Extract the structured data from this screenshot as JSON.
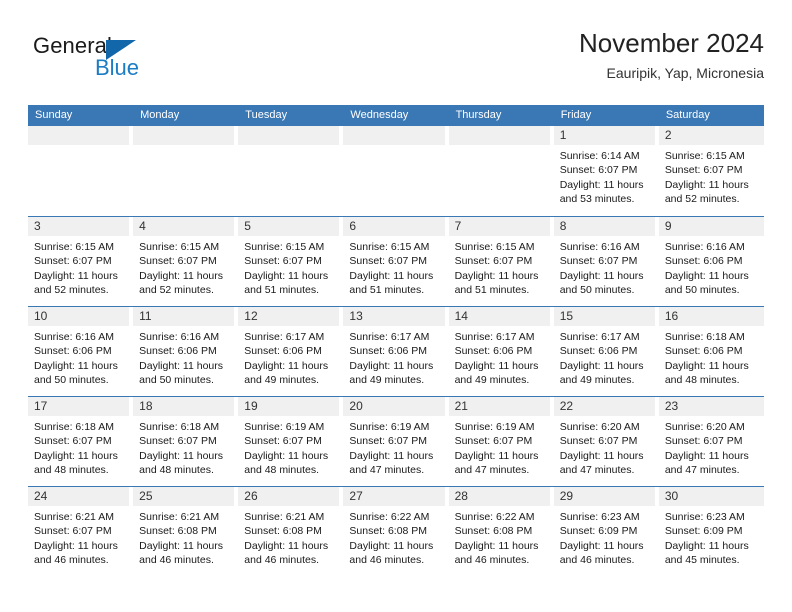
{
  "brand": {
    "name_top": "General",
    "name_bottom": "Blue",
    "accent_color": "#1c7cc4",
    "triangle_color": "#1267ab"
  },
  "header": {
    "title": "November 2024",
    "subtitle": "Eauripik, Yap, Micronesia"
  },
  "theme": {
    "header_blue": "#3a77b5",
    "daynum_band": "#f0f0f0",
    "text": "#1a1a1a"
  },
  "weekdays": [
    "Sunday",
    "Monday",
    "Tuesday",
    "Wednesday",
    "Thursday",
    "Friday",
    "Saturday"
  ],
  "weeks": [
    [
      {
        "day": "",
        "lines": []
      },
      {
        "day": "",
        "lines": []
      },
      {
        "day": "",
        "lines": []
      },
      {
        "day": "",
        "lines": []
      },
      {
        "day": "",
        "lines": []
      },
      {
        "day": "1",
        "lines": [
          "Sunrise: 6:14 AM",
          "Sunset: 6:07 PM",
          "Daylight: 11 hours",
          "and 53 minutes."
        ]
      },
      {
        "day": "2",
        "lines": [
          "Sunrise: 6:15 AM",
          "Sunset: 6:07 PM",
          "Daylight: 11 hours",
          "and 52 minutes."
        ]
      }
    ],
    [
      {
        "day": "3",
        "lines": [
          "Sunrise: 6:15 AM",
          "Sunset: 6:07 PM",
          "Daylight: 11 hours",
          "and 52 minutes."
        ]
      },
      {
        "day": "4",
        "lines": [
          "Sunrise: 6:15 AM",
          "Sunset: 6:07 PM",
          "Daylight: 11 hours",
          "and 52 minutes."
        ]
      },
      {
        "day": "5",
        "lines": [
          "Sunrise: 6:15 AM",
          "Sunset: 6:07 PM",
          "Daylight: 11 hours",
          "and 51 minutes."
        ]
      },
      {
        "day": "6",
        "lines": [
          "Sunrise: 6:15 AM",
          "Sunset: 6:07 PM",
          "Daylight: 11 hours",
          "and 51 minutes."
        ]
      },
      {
        "day": "7",
        "lines": [
          "Sunrise: 6:15 AM",
          "Sunset: 6:07 PM",
          "Daylight: 11 hours",
          "and 51 minutes."
        ]
      },
      {
        "day": "8",
        "lines": [
          "Sunrise: 6:16 AM",
          "Sunset: 6:07 PM",
          "Daylight: 11 hours",
          "and 50 minutes."
        ]
      },
      {
        "day": "9",
        "lines": [
          "Sunrise: 6:16 AM",
          "Sunset: 6:06 PM",
          "Daylight: 11 hours",
          "and 50 minutes."
        ]
      }
    ],
    [
      {
        "day": "10",
        "lines": [
          "Sunrise: 6:16 AM",
          "Sunset: 6:06 PM",
          "Daylight: 11 hours",
          "and 50 minutes."
        ]
      },
      {
        "day": "11",
        "lines": [
          "Sunrise: 6:16 AM",
          "Sunset: 6:06 PM",
          "Daylight: 11 hours",
          "and 50 minutes."
        ]
      },
      {
        "day": "12",
        "lines": [
          "Sunrise: 6:17 AM",
          "Sunset: 6:06 PM",
          "Daylight: 11 hours",
          "and 49 minutes."
        ]
      },
      {
        "day": "13",
        "lines": [
          "Sunrise: 6:17 AM",
          "Sunset: 6:06 PM",
          "Daylight: 11 hours",
          "and 49 minutes."
        ]
      },
      {
        "day": "14",
        "lines": [
          "Sunrise: 6:17 AM",
          "Sunset: 6:06 PM",
          "Daylight: 11 hours",
          "and 49 minutes."
        ]
      },
      {
        "day": "15",
        "lines": [
          "Sunrise: 6:17 AM",
          "Sunset: 6:06 PM",
          "Daylight: 11 hours",
          "and 49 minutes."
        ]
      },
      {
        "day": "16",
        "lines": [
          "Sunrise: 6:18 AM",
          "Sunset: 6:06 PM",
          "Daylight: 11 hours",
          "and 48 minutes."
        ]
      }
    ],
    [
      {
        "day": "17",
        "lines": [
          "Sunrise: 6:18 AM",
          "Sunset: 6:07 PM",
          "Daylight: 11 hours",
          "and 48 minutes."
        ]
      },
      {
        "day": "18",
        "lines": [
          "Sunrise: 6:18 AM",
          "Sunset: 6:07 PM",
          "Daylight: 11 hours",
          "and 48 minutes."
        ]
      },
      {
        "day": "19",
        "lines": [
          "Sunrise: 6:19 AM",
          "Sunset: 6:07 PM",
          "Daylight: 11 hours",
          "and 48 minutes."
        ]
      },
      {
        "day": "20",
        "lines": [
          "Sunrise: 6:19 AM",
          "Sunset: 6:07 PM",
          "Daylight: 11 hours",
          "and 47 minutes."
        ]
      },
      {
        "day": "21",
        "lines": [
          "Sunrise: 6:19 AM",
          "Sunset: 6:07 PM",
          "Daylight: 11 hours",
          "and 47 minutes."
        ]
      },
      {
        "day": "22",
        "lines": [
          "Sunrise: 6:20 AM",
          "Sunset: 6:07 PM",
          "Daylight: 11 hours",
          "and 47 minutes."
        ]
      },
      {
        "day": "23",
        "lines": [
          "Sunrise: 6:20 AM",
          "Sunset: 6:07 PM",
          "Daylight: 11 hours",
          "and 47 minutes."
        ]
      }
    ],
    [
      {
        "day": "24",
        "lines": [
          "Sunrise: 6:21 AM",
          "Sunset: 6:07 PM",
          "Daylight: 11 hours",
          "and 46 minutes."
        ]
      },
      {
        "day": "25",
        "lines": [
          "Sunrise: 6:21 AM",
          "Sunset: 6:08 PM",
          "Daylight: 11 hours",
          "and 46 minutes."
        ]
      },
      {
        "day": "26",
        "lines": [
          "Sunrise: 6:21 AM",
          "Sunset: 6:08 PM",
          "Daylight: 11 hours",
          "and 46 minutes."
        ]
      },
      {
        "day": "27",
        "lines": [
          "Sunrise: 6:22 AM",
          "Sunset: 6:08 PM",
          "Daylight: 11 hours",
          "and 46 minutes."
        ]
      },
      {
        "day": "28",
        "lines": [
          "Sunrise: 6:22 AM",
          "Sunset: 6:08 PM",
          "Daylight: 11 hours",
          "and 46 minutes."
        ]
      },
      {
        "day": "29",
        "lines": [
          "Sunrise: 6:23 AM",
          "Sunset: 6:09 PM",
          "Daylight: 11 hours",
          "and 46 minutes."
        ]
      },
      {
        "day": "30",
        "lines": [
          "Sunrise: 6:23 AM",
          "Sunset: 6:09 PM",
          "Daylight: 11 hours",
          "and 45 minutes."
        ]
      }
    ]
  ]
}
